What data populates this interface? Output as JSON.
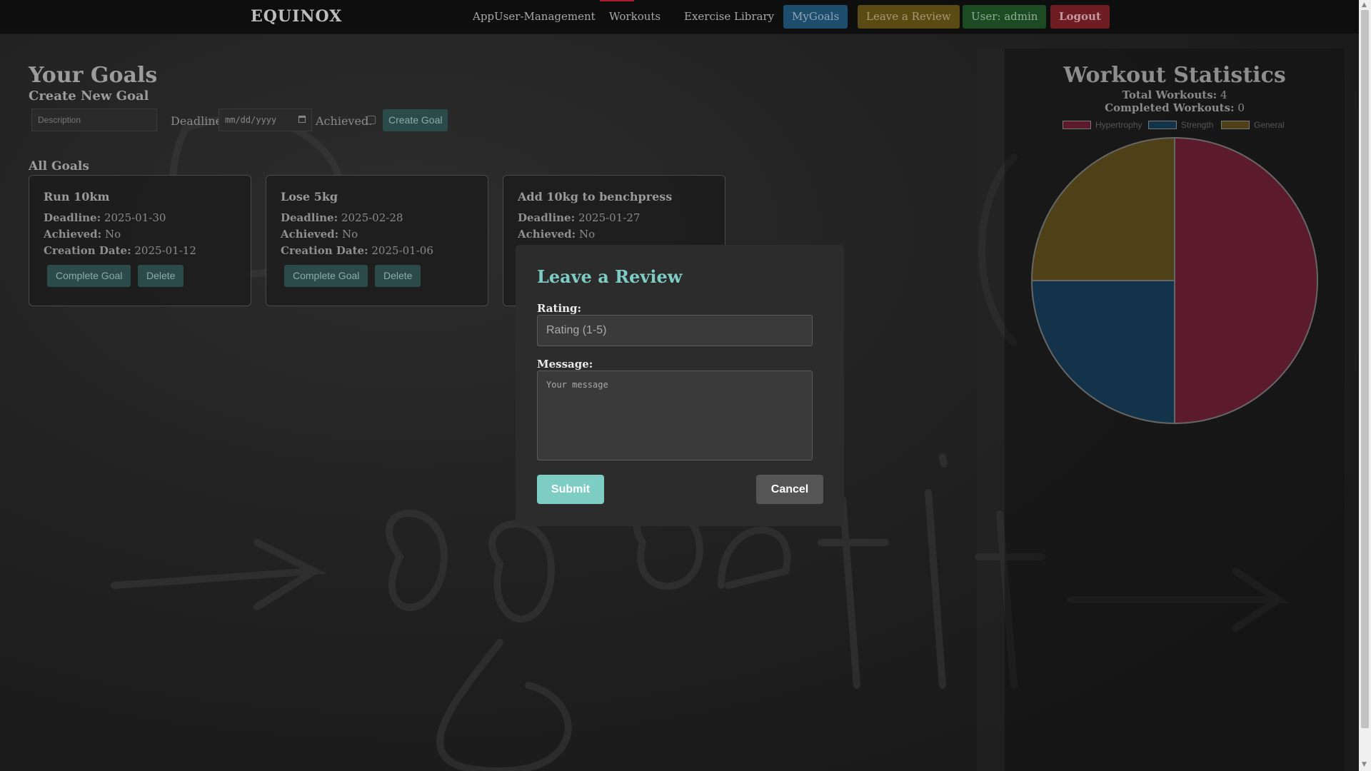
{
  "nav": {
    "brand": "EQUINOX",
    "links": [
      "AppUser-Management",
      "Workouts",
      "Exercise Library"
    ],
    "mygoals": "MyGoals",
    "review": "Leave a Review",
    "user": "User: admin",
    "logout": "Logout",
    "colors": {
      "mygoals": "#1e4e6e",
      "review": "#5a4a14",
      "user": "#1c4a22",
      "logout": "#6e1d22"
    }
  },
  "goals": {
    "title": "Your Goals",
    "create_title": "Create New Goal",
    "description_placeholder": "Description",
    "deadline_label": "Deadline:",
    "date_placeholder": "mm/dd/yyyy",
    "achieved_label": "Achieved:",
    "create_button": "Create Goal",
    "all_goals_title": "All Goals",
    "labels": {
      "deadline": "Deadline:",
      "achieved": "Achieved:",
      "creation": "Creation Date:"
    },
    "complete_label": "Complete Goal",
    "delete_label": "Delete",
    "cards": [
      {
        "title": "Run 10km",
        "deadline": "2025-01-30",
        "achieved": "No",
        "creation_date": "2025-01-12"
      },
      {
        "title": "Lose 5kg",
        "deadline": "2025-02-28",
        "achieved": "No",
        "creation_date": "2025-01-06"
      },
      {
        "title": "Add 10kg to benchpress",
        "deadline": "2025-01-27",
        "achieved": "No",
        "creation_date": ""
      }
    ]
  },
  "stats": {
    "title": "Workout Statistics",
    "total_label": "Total Workouts:",
    "total_value": "4",
    "completed_label": "Completed Workouts:",
    "completed_value": "0"
  },
  "chart_data": {
    "type": "pie",
    "categories": [
      "Hypertrophy",
      "Strength",
      "General"
    ],
    "values": [
      2,
      1,
      1
    ],
    "colors": [
      "#5c1b2c",
      "#123349",
      "#4f4117"
    ],
    "legend": "top"
  },
  "modal": {
    "title": "Leave a Review",
    "rating_label": "Rating:",
    "rating_placeholder": "Rating (1-5)",
    "message_label": "Message:",
    "message_placeholder": "Your message",
    "submit": "Submit",
    "cancel": "Cancel"
  }
}
